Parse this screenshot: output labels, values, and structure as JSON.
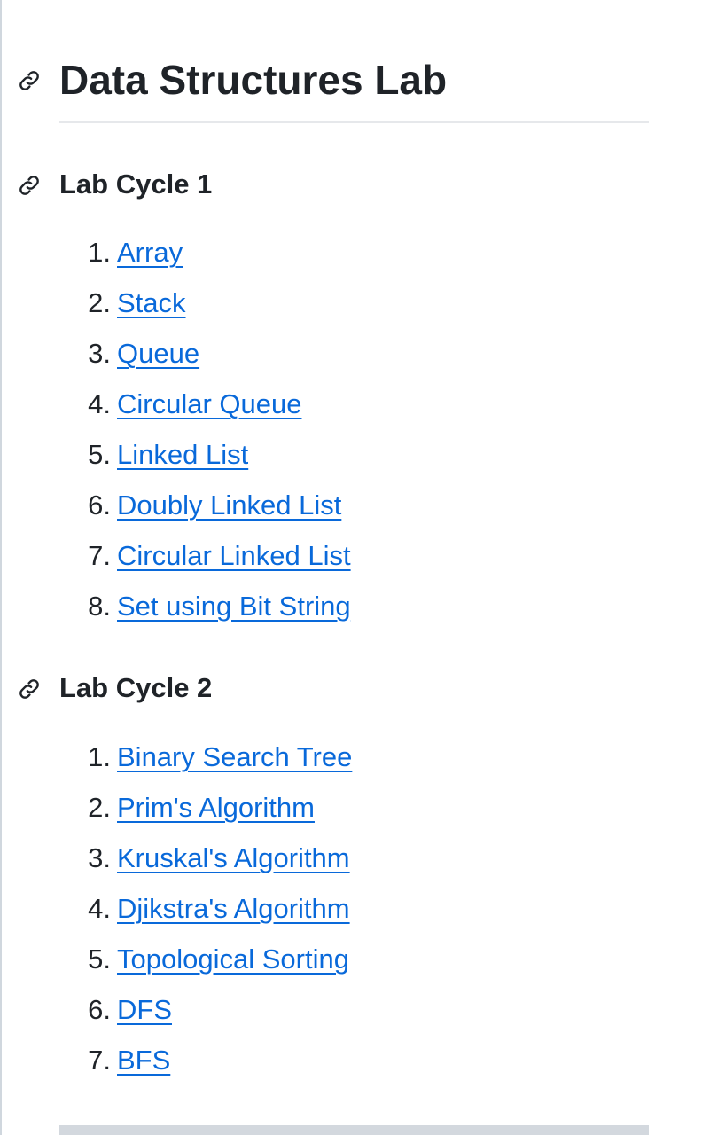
{
  "page": {
    "title": "Data Structures Lab"
  },
  "colors": {
    "link": "#0969da",
    "text": "#1f2328",
    "rule": "#e6e8eb"
  },
  "icons": {
    "anchor": "link-chain-icon"
  },
  "sections": [
    {
      "heading": "Lab Cycle 1",
      "items": [
        {
          "num": "1.",
          "label": "Array"
        },
        {
          "num": "2.",
          "label": "Stack"
        },
        {
          "num": "3.",
          "label": "Queue"
        },
        {
          "num": "4.",
          "label": "Circular Queue"
        },
        {
          "num": "5.",
          "label": "Linked List"
        },
        {
          "num": "6.",
          "label": "Doubly Linked List"
        },
        {
          "num": "7.",
          "label": "Circular Linked List"
        },
        {
          "num": "8.",
          "label": "Set using Bit String"
        }
      ]
    },
    {
      "heading": "Lab Cycle 2",
      "items": [
        {
          "num": "1.",
          "label": "Binary Search Tree"
        },
        {
          "num": "2.",
          "label": "Prim's Algorithm"
        },
        {
          "num": "3.",
          "label": "Kruskal's Algorithm"
        },
        {
          "num": "4.",
          "label": "Djikstra's Algorithm"
        },
        {
          "num": "5.",
          "label": "Topological Sorting"
        },
        {
          "num": "6.",
          "label": "DFS"
        },
        {
          "num": "7.",
          "label": "BFS"
        }
      ]
    }
  ]
}
